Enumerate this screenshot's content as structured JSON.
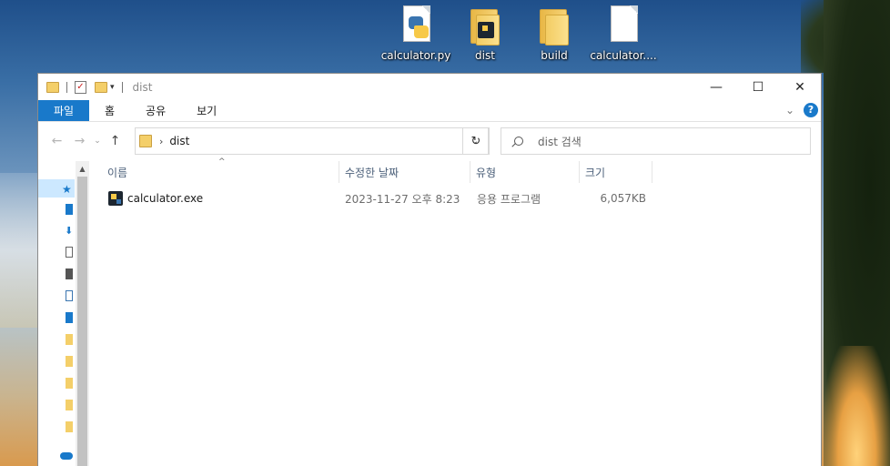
{
  "desktop": {
    "icons": [
      {
        "label": "calculator.py",
        "icon": "python-file-icon"
      },
      {
        "label": "dist",
        "icon": "folder-icon"
      },
      {
        "label": "build",
        "icon": "folder-icon"
      },
      {
        "label": "calculator....",
        "icon": "file-icon"
      }
    ]
  },
  "window": {
    "title": "dist",
    "controls": {
      "minimize": "—",
      "maximize": "☐",
      "close": "✕"
    }
  },
  "ribbon": {
    "tabs": [
      "파일",
      "홈",
      "공유",
      "보기"
    ],
    "collapse_icon": "⌄",
    "help_label": "?"
  },
  "nav": {
    "back": "←",
    "forward": "→",
    "recent": "⌄",
    "up": "↑",
    "address": {
      "path": "dist",
      "separator": "›",
      "dropdown": "⌄"
    },
    "refresh": "↻",
    "search_placeholder": "dist 검색"
  },
  "columns": [
    {
      "label": "이름"
    },
    {
      "label": "수정한 날짜"
    },
    {
      "label": "유형"
    },
    {
      "label": "크기"
    }
  ],
  "sort_indicator": "^",
  "files": [
    {
      "name": "calculator.exe",
      "modified": "2023-11-27 오후 8:23",
      "type": "응용 프로그램",
      "size": "6,057KB"
    }
  ],
  "colors": {
    "accent": "#1979ca",
    "selection": "#cce8ff"
  }
}
